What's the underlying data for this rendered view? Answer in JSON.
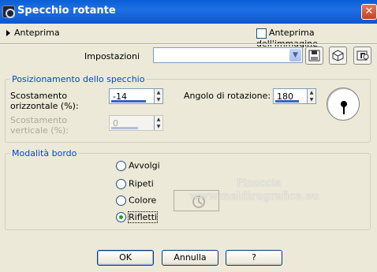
{
  "window": {
    "title": "Specchio rotante",
    "close_icon": "close-icon"
  },
  "preview": {
    "toggle_label": "Anteprima",
    "image_preview_label": "Anteprima dell'immagine",
    "image_preview_checked": false
  },
  "settings": {
    "label": "Impostazioni",
    "value": ""
  },
  "mirror_position": {
    "legend": "Posizionamento dello specchio",
    "horizontal_label_1": "Scostamento",
    "horizontal_label_2": "orizzontale (%):",
    "horizontal_value": "-14",
    "vertical_label_1": "Scostamento",
    "vertical_label_2": "verticale (%):",
    "vertical_value": "0",
    "rotation_label": "Angolo di rotazione:",
    "rotation_value": "180"
  },
  "edge_mode": {
    "legend": "Modalità bordo",
    "options": [
      "Avvolgi",
      "Ripeti",
      "Colore",
      "Rifletti"
    ],
    "selected": "Rifletti"
  },
  "watermark": {
    "line1": "Pinuccia",
    "line2": "www.maldiregrafica.eu"
  },
  "buttons": {
    "ok": "OK",
    "cancel": "Annulla",
    "help": "?"
  }
}
